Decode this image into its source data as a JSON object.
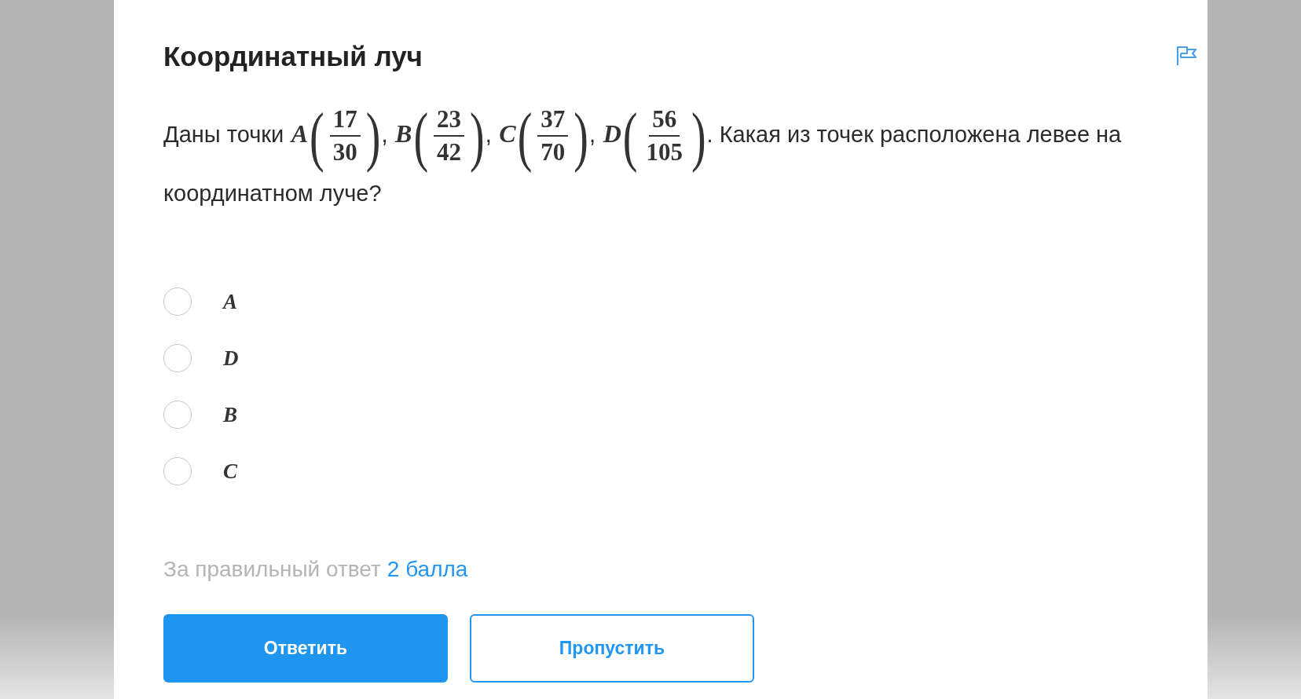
{
  "task": {
    "title": "Координатный луч",
    "question": [
      {
        "kind": "text",
        "text": "Даны точки"
      },
      {
        "kind": "variable",
        "text": "A"
      },
      {
        "kind": "paren",
        "text": "("
      },
      {
        "kind": "fraction",
        "numerator": "17",
        "denominator": "30"
      },
      {
        "kind": "paren",
        "text": ")"
      },
      {
        "kind": "text",
        "text": ","
      },
      {
        "kind": "variable",
        "text": "B"
      },
      {
        "kind": "paren",
        "text": "("
      },
      {
        "kind": "fraction",
        "numerator": "23",
        "denominator": "42"
      },
      {
        "kind": "paren",
        "text": ")"
      },
      {
        "kind": "text",
        "text": ","
      },
      {
        "kind": "variable",
        "text": "C"
      },
      {
        "kind": "paren",
        "text": "("
      },
      {
        "kind": "fraction",
        "numerator": "37",
        "denominator": "70"
      },
      {
        "kind": "paren",
        "text": ")"
      },
      {
        "kind": "text",
        "text": ","
      },
      {
        "kind": "variable",
        "text": "D"
      },
      {
        "kind": "paren",
        "text": "("
      },
      {
        "kind": "fraction",
        "numerator": "56",
        "denominator": "105"
      },
      {
        "kind": "paren",
        "text": ")"
      },
      {
        "kind": "text",
        "text": ". Какая из точек расположена левее на координатном луче?"
      }
    ],
    "options": [
      {
        "label": "A",
        "selected": false
      },
      {
        "label": "D",
        "selected": false
      },
      {
        "label": "B",
        "selected": false
      },
      {
        "label": "C",
        "selected": false
      }
    ],
    "reward": {
      "label": "За правильный ответ",
      "points": "2 балла"
    },
    "buttons": [
      {
        "kind": "primary",
        "label": "Ответить"
      },
      {
        "kind": "secondary",
        "label": "Пропустить"
      }
    ]
  }
}
